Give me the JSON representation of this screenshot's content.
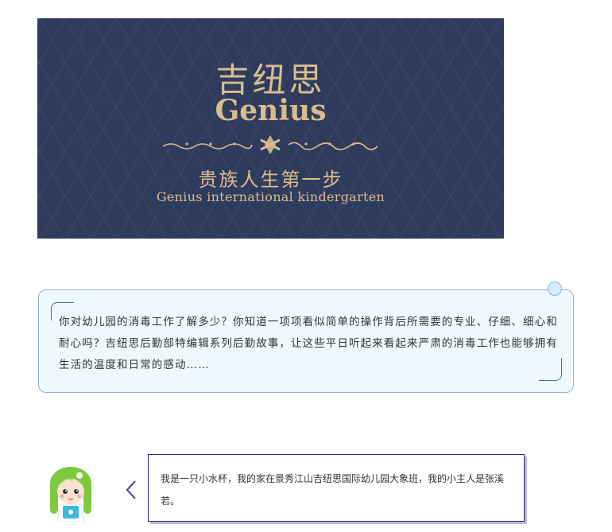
{
  "banner": {
    "cn_title": "吉纽思",
    "en_title": "Genius",
    "slogan": "贵族人生第一步",
    "subtitle": "Genius international kindergarten",
    "colors": {
      "background": "#2f3b5c",
      "gold": "#d9bd8f"
    }
  },
  "intro": {
    "text": "你对幼儿园的消毒工作了解多少？你知道一项项看似简单的操作背后所需要的专业、仔细、细心和耐心吗？吉纽思后勤部特编辑系列后勤故事，让这些平日听起来看起来严肃的消毒工作也能够拥有生活的温度和日常的感动……",
    "colors": {
      "background": "#eef9fd",
      "border": "#8fb1d8"
    }
  },
  "dialog": {
    "avatar_icon": "cartoon-girl-avatar-icon",
    "chevron_icon": "chevron-left-icon",
    "text": "我是一只小水杯，我的家在景秀江山吉纽思国际幼儿园大象班，我的小主人是张溪若。",
    "colors": {
      "border": "#2c2c7a",
      "chevron": "#3a3ab0"
    }
  }
}
